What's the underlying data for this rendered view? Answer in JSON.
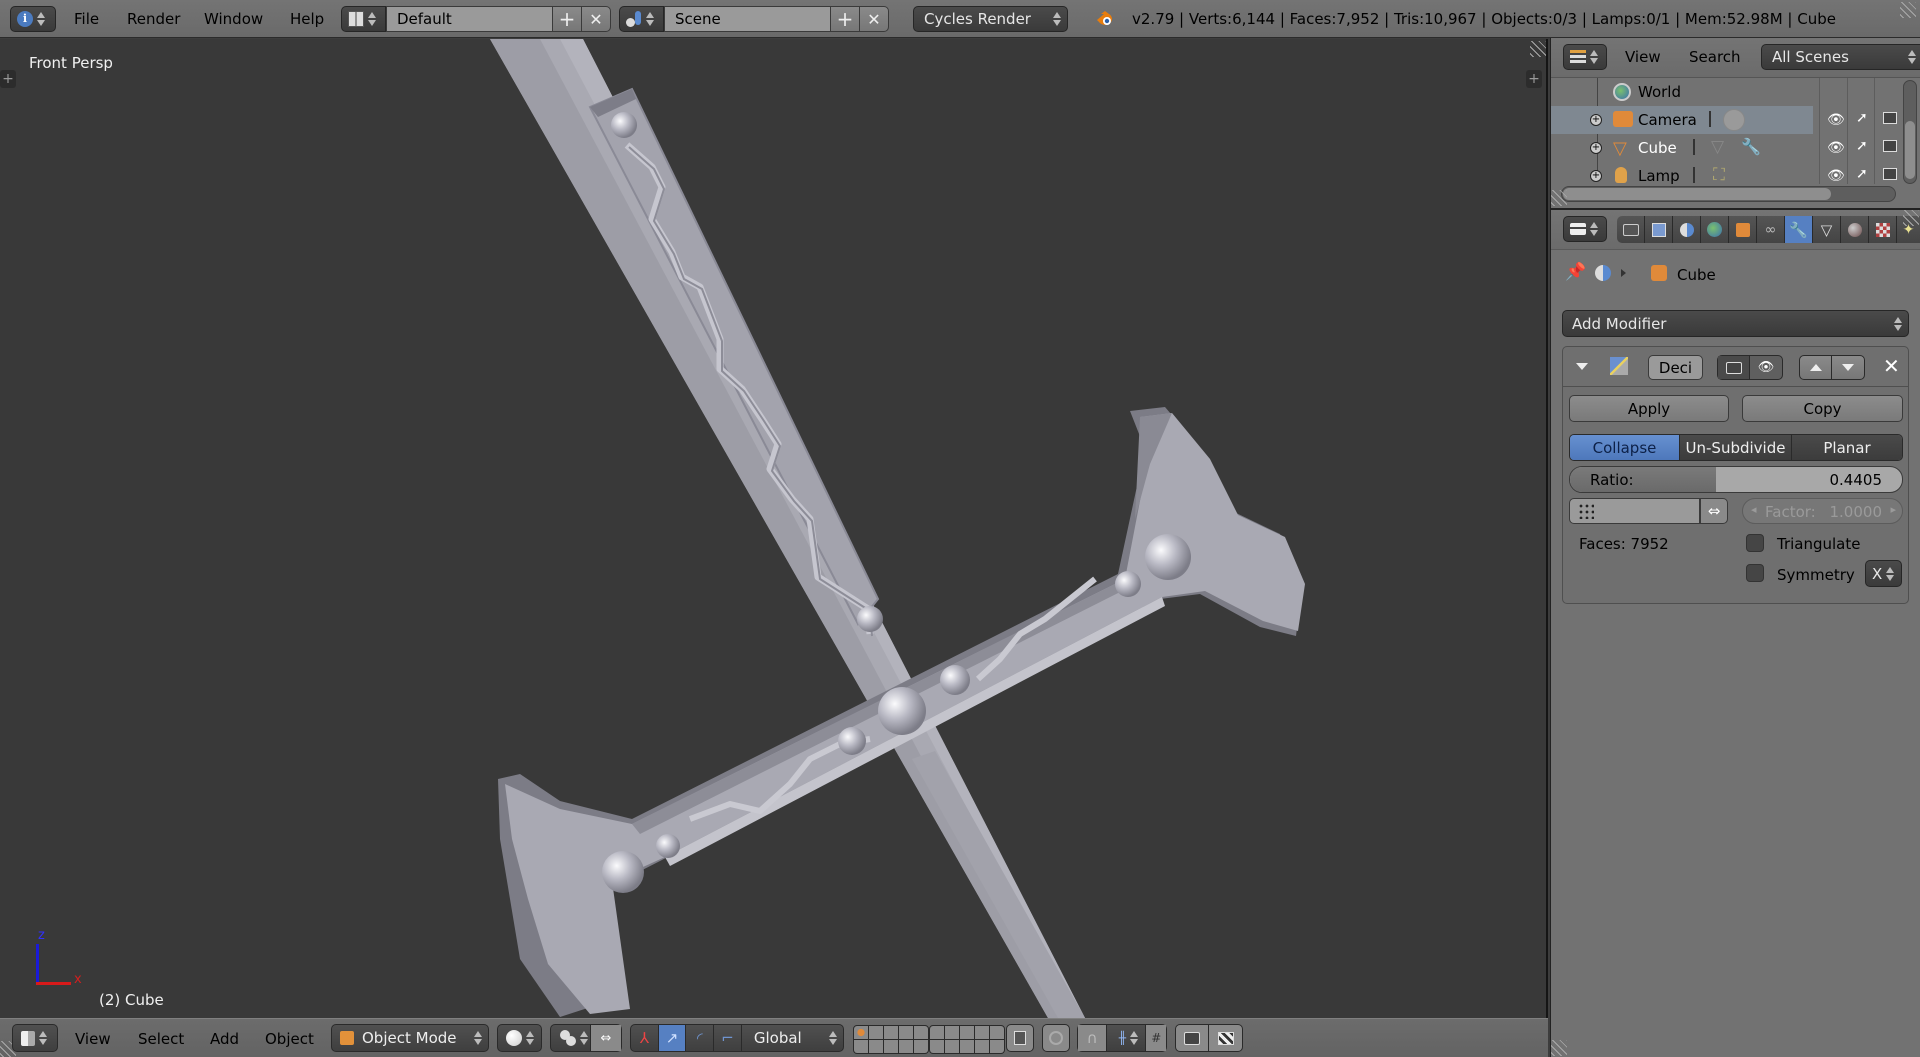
{
  "topbar": {
    "menus": [
      "File",
      "Render",
      "Window",
      "Help"
    ],
    "screen_layout": "Default",
    "scene": "Scene",
    "render_engine": "Cycles Render",
    "stats": "v2.79 | Verts:6,144 | Faces:7,952 | Tris:10,967 | Objects:0/3 | Lamps:0/1 | Mem:52.98M | Cube",
    "add_symbol": "+",
    "close_symbol": "✕"
  },
  "viewport": {
    "view_label": "Front Persp",
    "object_label": "(2) Cube",
    "axis_x": "x",
    "axis_z": "z"
  },
  "bottombar": {
    "menus": [
      "View",
      "Select",
      "Add",
      "Object"
    ],
    "mode": "Object Mode",
    "orientation": "Global"
  },
  "outliner": {
    "menus": [
      "View",
      "Search"
    ],
    "display_mode": "All Scenes",
    "items": [
      {
        "label": "World",
        "icon": "world-icon",
        "selected": false
      },
      {
        "label": "Camera",
        "icon": "camera-object-icon",
        "selected": true
      },
      {
        "label": "Cube",
        "icon": "mesh-object-icon",
        "selected": false
      },
      {
        "label": "Lamp",
        "icon": "lamp-object-icon",
        "selected": false
      }
    ]
  },
  "properties": {
    "tabs": [
      "render",
      "render-layers",
      "scene",
      "world",
      "object",
      "constraints",
      "modifiers",
      "data",
      "material",
      "texture",
      "particles"
    ],
    "active_tab": "modifiers",
    "context_object": "Cube",
    "add_modifier_label": "Add Modifier",
    "modifier": {
      "name": "Deci",
      "apply_label": "Apply",
      "copy_label": "Copy",
      "modes": [
        "Collapse",
        "Un-Subdivide",
        "Planar"
      ],
      "active_mode": "Collapse",
      "ratio_label": "Ratio:",
      "ratio_value": "0.4405",
      "ratio_fraction": 0.4405,
      "factor_label": "Factor:",
      "factor_value": "1.0000",
      "faces_label": "Faces: 7952",
      "triangulate_label": "Triangulate",
      "triangulate_checked": false,
      "symmetry_label": "Symmetry",
      "symmetry_checked": false,
      "symmetry_axis": "X"
    }
  },
  "colors": {
    "accent": "#5680c2",
    "viewport_bg": "#393939",
    "panel_bg": "#727272"
  }
}
